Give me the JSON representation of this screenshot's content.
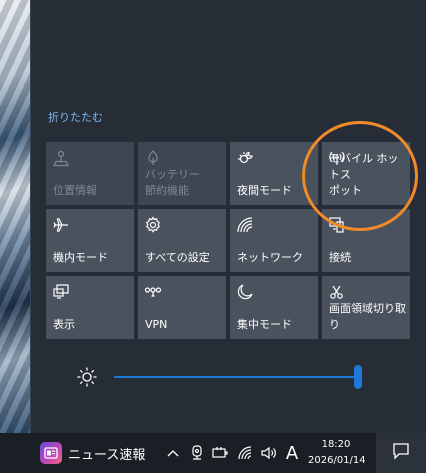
{
  "action_center": {
    "collapse_label": "折りたたむ",
    "tiles": [
      {
        "icon": "location-icon",
        "label": "位置情報",
        "enabled": false
      },
      {
        "icon": "battery-saver-icon",
        "label": "バッテリー\n節約機能",
        "enabled": false
      },
      {
        "icon": "night-light-icon",
        "label": "夜間モード",
        "enabled": true
      },
      {
        "icon": "mobile-hotspot-icon",
        "label": "モバイル ホットス\nポット",
        "enabled": true
      },
      {
        "icon": "airplane-icon",
        "label": "機内モード",
        "enabled": true
      },
      {
        "icon": "settings-gear-icon",
        "label": "すべての設定",
        "enabled": true
      },
      {
        "icon": "network-icon",
        "label": "ネットワーク",
        "enabled": true
      },
      {
        "icon": "connect-icon",
        "label": "接続",
        "enabled": true
      },
      {
        "icon": "project-icon",
        "label": "表示",
        "enabled": true
      },
      {
        "icon": "vpn-icon",
        "label": "VPN",
        "enabled": true
      },
      {
        "icon": "focus-assist-moon-icon",
        "label": "集中モード",
        "enabled": true
      },
      {
        "icon": "screen-snip-icon",
        "label": "画面領域切り取り",
        "enabled": true
      }
    ],
    "brightness_percent": 100
  },
  "taskbar": {
    "news_label": "ニュース速報",
    "ime_label": "A",
    "time": "18:20",
    "date": "2026/01/14"
  },
  "colors": {
    "accent": "#1e78d7",
    "highlight_circle": "#f08a2a",
    "tile": "#4a525d",
    "tile_disabled": "#3e4651"
  }
}
